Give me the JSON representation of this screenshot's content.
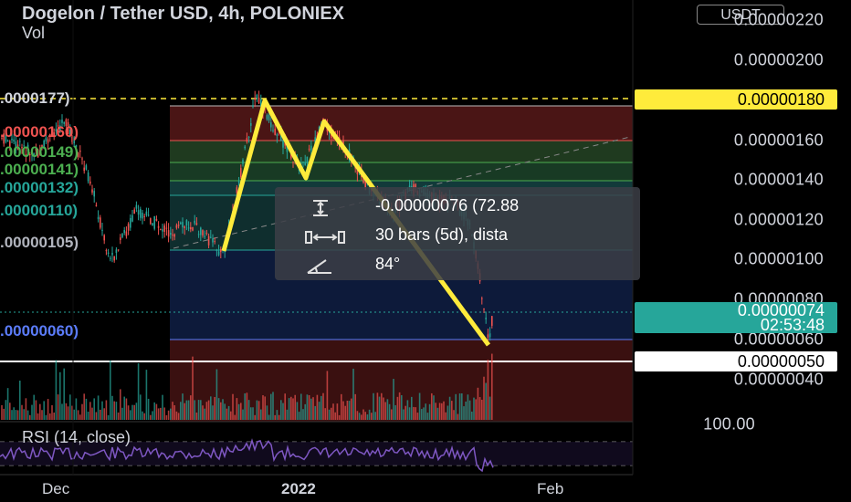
{
  "header": {
    "title": "Dogelon / Tether USD, 4h, POLONIEX",
    "volume_label": "Vol",
    "currency_button": "USDT"
  },
  "price_axis": {
    "labels": [
      "0.00000220",
      "0.00000200",
      "0.00000160",
      "0.00000140",
      "0.00000120",
      "0.00000100",
      "0.00000080",
      "0.00000060",
      "0.00000040"
    ],
    "rsi_label": "100.00"
  },
  "price_tags": {
    "target": "0.00000180",
    "current": "0.00000074",
    "countdown": "02:53:48",
    "support": "0.00000050"
  },
  "fib_levels": [
    {
      "label": ".0000177)",
      "color": "#d1d4dc"
    },
    {
      "label": ".00000160)",
      "color": "#ef5350"
    },
    {
      "label": ".00000149)",
      "color": "#4caf50"
    },
    {
      "label": ".00000141)",
      "color": "#4caf50"
    },
    {
      "label": ".00000132)",
      "color": "#26a69a"
    },
    {
      "label": ".00000110)",
      "color": "#26a69a"
    },
    {
      "label": ".00000105)",
      "color": "#b2b5be"
    },
    {
      "label": ".00000060)",
      "color": "#5b7cfa"
    }
  ],
  "measure_popup": {
    "price_range": "-0.00000076 (72.88",
    "bars": "30 bars (5d), dista",
    "angle": "84°"
  },
  "rsi": {
    "label": "RSI (14, close)"
  },
  "time_axis": {
    "labels": [
      "Dec",
      "2022",
      "Feb"
    ]
  },
  "colors": {
    "up": "#26a69a",
    "down": "#ef5350",
    "target": "#ffeb3b",
    "rsi": "#7e57c2"
  },
  "icons": [
    "price-range-icon",
    "bars-range-icon",
    "angle-icon"
  ],
  "chart_data": {
    "type": "candlestick",
    "description_visible": "Dogelon price with yellow zig-zag pattern from ~0.00000100 up to ~0.00000180 then down to ~0.00000060",
    "pattern_points_price": [
      1e-06,
      1.8e-06,
      1.38e-06,
      1.7e-06,
      1.15e-06,
      6e-07
    ],
    "ylim": [
      4e-07,
      2.25e-06
    ]
  }
}
